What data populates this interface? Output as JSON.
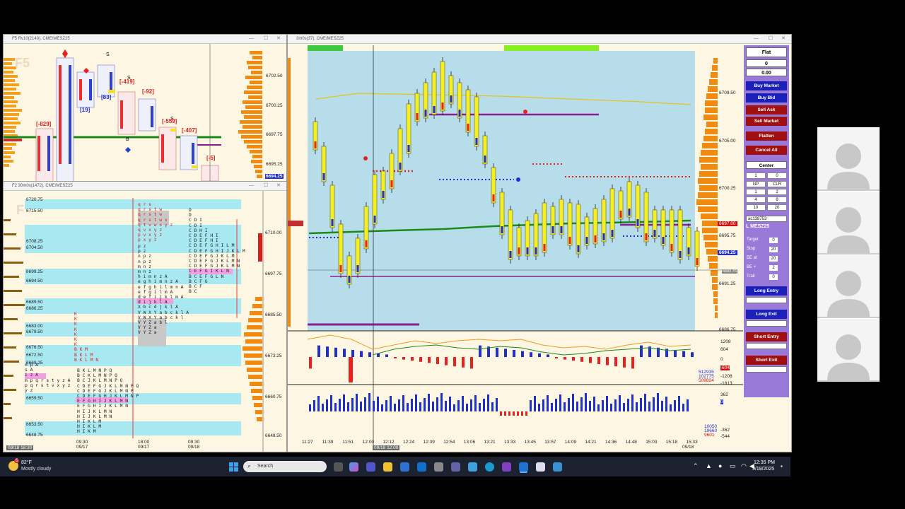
{
  "windows": {
    "f5": {
      "title": "F5 Rv10(2140), CME/MESZ25",
      "watermark": "F5",
      "prices": [
        "6702.50",
        "6700.25",
        "6697.75",
        "6695.25"
      ],
      "current_price": "6694.25",
      "deltas": [
        "[-829]",
        "[19]",
        "[83]",
        "[-419]",
        "[-92]",
        "[-559]",
        "[-407]",
        "[-5]"
      ]
    },
    "f2": {
      "title": "F2 30m0s(1472), CME/MESZ25",
      "watermark": "F",
      "left_prices": [
        "6720.75",
        "6715.50",
        "6708.25",
        "6704.50",
        "6699.25",
        "6694.50",
        "6689.50",
        "6686.25",
        "6683.00",
        "6679.50",
        "6676.50",
        "6672.50",
        "6669.25",
        "6659.50",
        "6653.50",
        "6648.75"
      ],
      "right_prices": [
        "6710.00",
        "6697.75",
        "6685.50",
        "6673.25",
        "6660.75",
        "6648.50"
      ],
      "time_labels": [
        {
          "t": "09:30",
          "d": "09/17"
        },
        {
          "t": "18:00",
          "d": "09/17"
        },
        {
          "t": "09:30",
          "d": "09/18"
        }
      ],
      "date_left": "09/18 18:30"
    },
    "main": {
      "title": "3m0s(37), CME/MESZ25",
      "prices": [
        "6709.50",
        "6705.00",
        "6700.25",
        "6695.75",
        "6691.25",
        "6686.75"
      ],
      "price_flag_red": "6697.00",
      "price_flag_blue": "6694.25",
      "price_flag_gray": "6692.75",
      "ind1_scale": [
        "1208",
        "604",
        "0",
        "-604",
        "-1208",
        "-1813"
      ],
      "ind1_values": [
        "512935",
        "102775",
        "509824"
      ],
      "ind2_scale": [
        "362",
        "0",
        "-362",
        "-544"
      ],
      "ind2_values": [
        "10050",
        "19660",
        "9601"
      ],
      "times": [
        "11:27",
        "11:39",
        "11:51",
        "12:00",
        "12:12",
        "12:24",
        "12:39",
        "12:54",
        "13:06",
        "13:21",
        "13:33",
        "13:45",
        "13:57",
        "14:09",
        "14:21",
        "14:36",
        "14:48",
        "15:03",
        "15:18",
        "15:33"
      ],
      "date_cursor": "09/18 12:00",
      "date_end": "09/18"
    }
  },
  "order_panel": {
    "status": "Flat",
    "position": "0",
    "pnl": "0.00",
    "buttons": {
      "buy_market": "Buy Market",
      "buy_bid": "Buy Bid",
      "sell_ask": "Sell Ask",
      "sell_market": "Sell Market",
      "flatten": "Flatten",
      "cancel_all": "Cancel All",
      "center": "Center"
    },
    "qty_value": "1",
    "qty_right": "0",
    "grid": [
      "NP",
      "CLR",
      "1",
      "2",
      "4",
      "8",
      "10",
      "20"
    ],
    "account": "ac138753",
    "symbol": "L MESZ25",
    "fields": [
      {
        "label": "Target",
        "value": "0"
      },
      {
        "label": "Stop",
        "value": "20"
      },
      {
        "label": "BE at",
        "value": "20"
      },
      {
        "label": "BE +",
        "value": "2"
      },
      {
        "label": "Trail",
        "value": "0"
      }
    ],
    "long_entry": "Long Entry",
    "long_exit": "Long Exit",
    "short_entry": "Short Entry",
    "short_exit": "Short Exit"
  },
  "taskbar": {
    "temp": "82°F",
    "weather": "Mostly cloudy",
    "weather_badge": "5",
    "search": "Search",
    "time": "12:35 PM",
    "date": "9/18/2025"
  },
  "colors": {
    "accent_blue": "#1f2ed8",
    "accent_red": "#d01010",
    "panel": "#9a7ad8",
    "chart_bg": "#b7dcea"
  }
}
